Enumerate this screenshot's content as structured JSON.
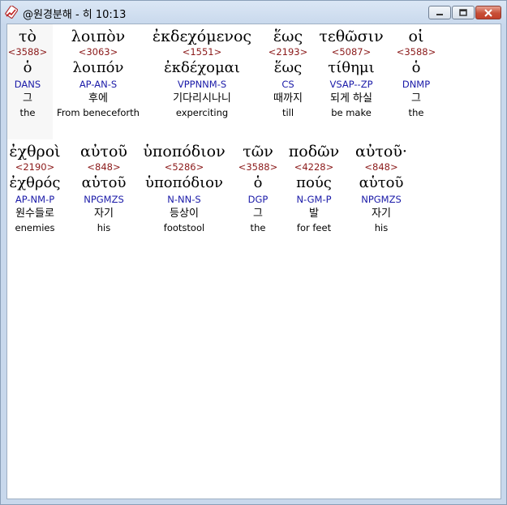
{
  "window": {
    "title": "@원경분해 - 히 10:13",
    "controls": {
      "minimize": "minimize-button",
      "maximize": "maximize-button",
      "close": "close-button"
    }
  },
  "rows": [
    {
      "words": [
        {
          "greek": "τὸ",
          "strong": "<3588>",
          "lemma": "ὁ",
          "morph": "DANS",
          "korean": "그",
          "english": "the"
        },
        {
          "greek": "λοιπὸν",
          "strong": "<3063>",
          "lemma": "λοιπόν",
          "morph": "AP-AN-S",
          "korean": "후에",
          "english": "From beneceforth"
        },
        {
          "greek": "ἐκδεχόμενος",
          "strong": "<1551>",
          "lemma": "ἐκδέχομαι",
          "morph": "VPPNNM-S",
          "korean": "기다리시나니",
          "english": "experciting"
        },
        {
          "greek": "ἕως",
          "strong": "<2193>",
          "lemma": "ἕως",
          "morph": "CS",
          "korean": "때까지",
          "english": "till"
        },
        {
          "greek": "τεθῶσιν",
          "strong": "<5087>",
          "lemma": "τίθημι",
          "morph": "VSAP--ZP",
          "korean": "되게 하실",
          "english": "be make"
        },
        {
          "greek": "οἱ",
          "strong": "<3588>",
          "lemma": "ὁ",
          "morph": "DNMP",
          "korean": "그",
          "english": "the"
        }
      ]
    },
    {
      "words": [
        {
          "greek": "ἐχθροὶ",
          "strong": "<2190>",
          "lemma": "ἐχθρός",
          "morph": "AP-NM-P",
          "korean": "원수들로",
          "english": "enemies"
        },
        {
          "greek": "αὐτοῦ",
          "strong": "<848>",
          "lemma": "αὑτοῦ",
          "morph": "NPGMZS",
          "korean": "자기",
          "english": "his"
        },
        {
          "greek": "ὑποπόδιον",
          "strong": "<5286>",
          "lemma": "ὑποπόδιον",
          "morph": "N-NN-S",
          "korean": "등상이",
          "english": "footstool"
        },
        {
          "greek": "τῶν",
          "strong": "<3588>",
          "lemma": "ὁ",
          "morph": "DGP",
          "korean": "그",
          "english": "the"
        },
        {
          "greek": "ποδῶν",
          "strong": "<4228>",
          "lemma": "πούς",
          "morph": "N-GM-P",
          "korean": "발",
          "english": "for feet"
        },
        {
          "greek": "αὐτοῦ·",
          "strong": "<848>",
          "lemma": "αὑτοῦ",
          "morph": "NPGMZS",
          "korean": "자기",
          "english": "his"
        }
      ]
    }
  ]
}
